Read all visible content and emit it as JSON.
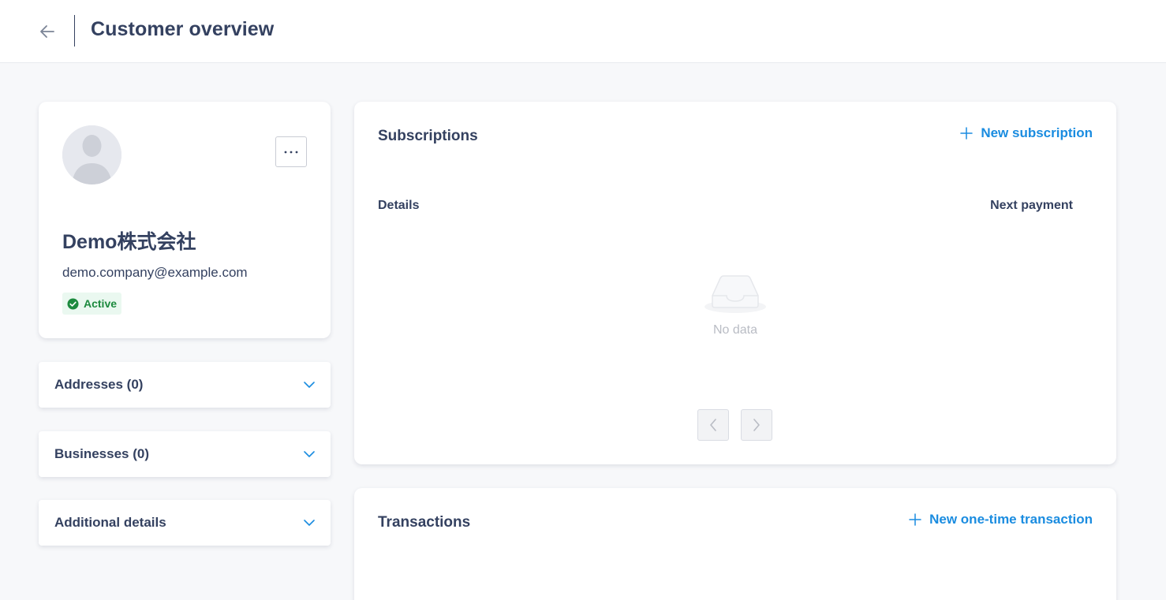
{
  "header": {
    "title": "Customer overview"
  },
  "profile": {
    "name": "Demo株式会社",
    "email": "demo.company@example.com",
    "status": "Active"
  },
  "sections": [
    {
      "label": "Addresses (0)"
    },
    {
      "label": "Businesses (0)"
    },
    {
      "label": "Additional details"
    }
  ],
  "subscriptions": {
    "title": "Subscriptions",
    "action_label": "New subscription",
    "columns": [
      "Details",
      "Next payment"
    ],
    "empty_text": "No data"
  },
  "transactions": {
    "title": "Transactions",
    "action_label": "New one-time transaction"
  },
  "colors": {
    "text": "#344160",
    "accent": "#1a8ce0",
    "success": "#1c8a3e",
    "background": "#f7f8fa"
  },
  "icons": [
    "arrow-left-icon",
    "ellipsis-icon",
    "user-placeholder-icon",
    "check-circle-icon",
    "chevron-down-icon",
    "plus-icon",
    "empty-inbox-icon",
    "chevron-left-icon",
    "chevron-right-icon"
  ]
}
